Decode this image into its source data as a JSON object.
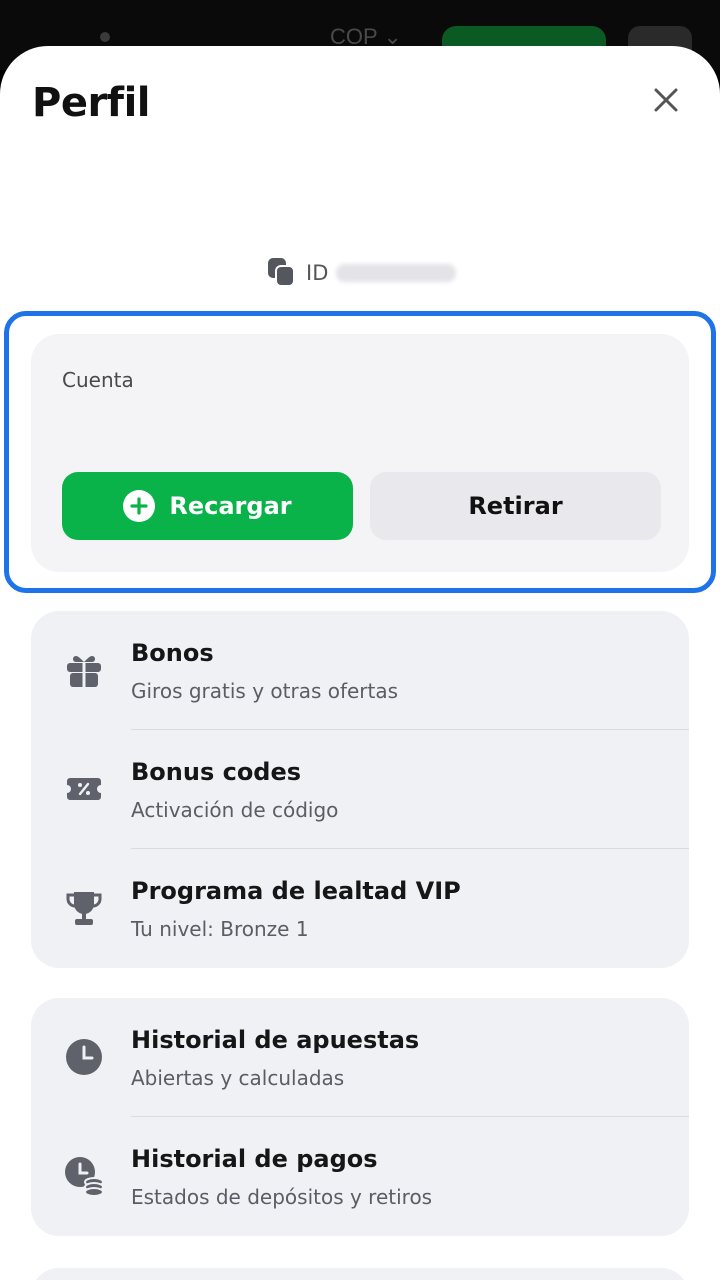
{
  "background_header": {
    "currency": "COP"
  },
  "sheet": {
    "title": "Perfil",
    "id_label": "ID"
  },
  "account": {
    "label": "Cuenta",
    "recharge_label": "Recargar",
    "withdraw_label": "Retirar"
  },
  "menu_group_1": [
    {
      "title": "Bonos",
      "subtitle": "Giros gratis y otras ofertas",
      "icon": "gift-icon"
    },
    {
      "title": "Bonus codes",
      "subtitle": "Activación de código",
      "icon": "coupon-icon"
    },
    {
      "title": "Programa de lealtad VIP",
      "subtitle": "Tu nivel: Bronze 1",
      "icon": "trophy-icon"
    }
  ],
  "menu_group_2": [
    {
      "title": "Historial de apuestas",
      "subtitle": "Abiertas y calculadas",
      "icon": "clock-icon"
    },
    {
      "title": "Historial de pagos",
      "subtitle": "Estados de depósitos y retiros",
      "icon": "clock-coins-icon"
    }
  ],
  "colors": {
    "accent_green": "#0ab34a",
    "highlight_blue": "#1e73e8",
    "icon_gray": "#5f616b"
  }
}
